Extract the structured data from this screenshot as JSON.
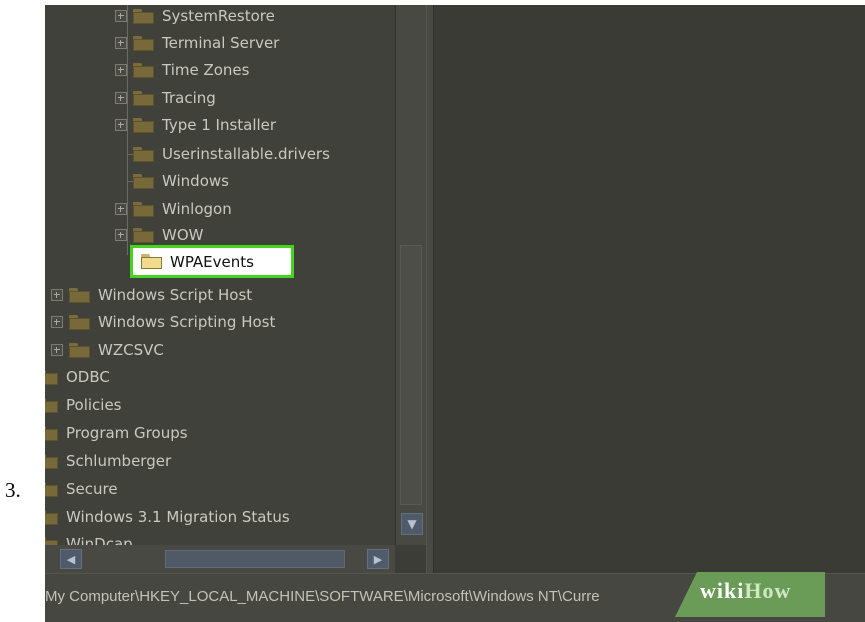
{
  "step_number": "3.",
  "tree": {
    "items": [
      {
        "label": "SystemRestore",
        "expandable": true
      },
      {
        "label": "Terminal Server",
        "expandable": true
      },
      {
        "label": "Time Zones",
        "expandable": true
      },
      {
        "label": "Tracing",
        "expandable": true
      },
      {
        "label": "Type 1 Installer",
        "expandable": true
      },
      {
        "label": "Userinstallable.drivers",
        "expandable": false
      },
      {
        "label": "Windows",
        "expandable": false
      },
      {
        "label": "Winlogon",
        "expandable": true
      },
      {
        "label": "WOW",
        "expandable": true
      },
      {
        "label": "WPAEvents",
        "expandable": false,
        "selected": true
      },
      {
        "label": "Windows Script Host",
        "expandable": true
      },
      {
        "label": "Windows Scripting Host",
        "expandable": true
      },
      {
        "label": "WZCSVC",
        "expandable": true
      },
      {
        "label": "ODBC",
        "expandable": false
      },
      {
        "label": "Policies",
        "expandable": false
      },
      {
        "label": "Program Groups",
        "expandable": false
      },
      {
        "label": "Schlumberger",
        "expandable": false
      },
      {
        "label": "Secure",
        "expandable": false
      },
      {
        "label": "Windows 3.1 Migration Status",
        "expandable": false
      },
      {
        "label": "WinDcap",
        "expandable": false
      }
    ]
  },
  "status_bar": {
    "path": "My Computer\\HKEY_LOCAL_MACHINE\\SOFTWARE\\Microsoft\\Windows NT\\Curre"
  },
  "watermark": {
    "part1": "wiki",
    "part2": "How"
  },
  "icons": {
    "folder": "folder-icon",
    "expander": "plus-expander-icon",
    "scroll_down": "chevron-down-icon",
    "scroll_left": "chevron-left-icon",
    "scroll_right": "chevron-right-icon"
  },
  "colors": {
    "highlight_border": "#44d61c",
    "overlay_background": "#3d3d37"
  }
}
